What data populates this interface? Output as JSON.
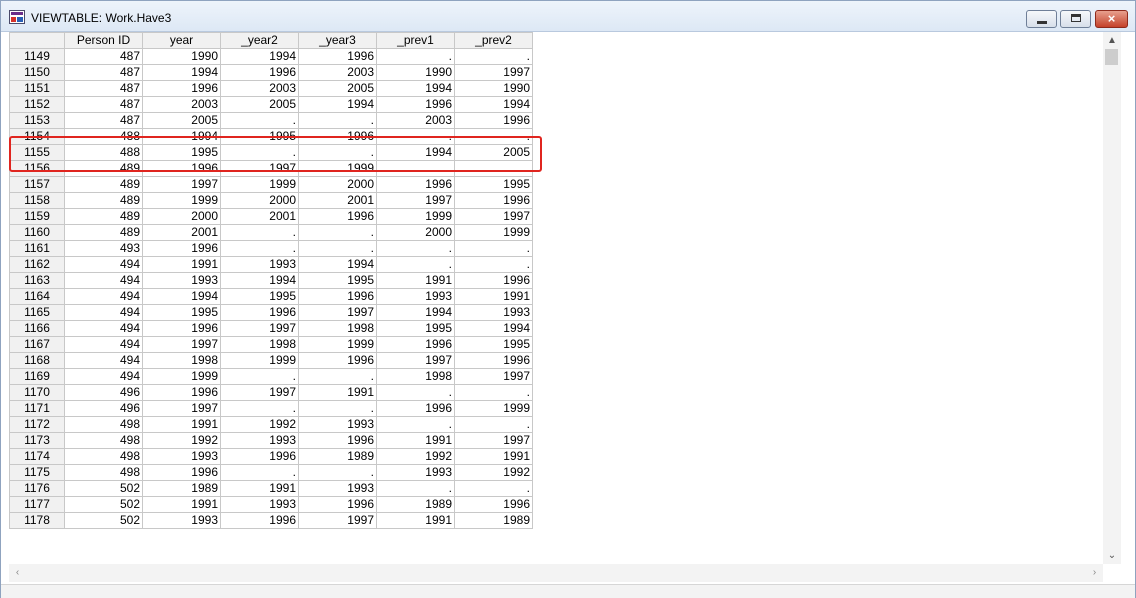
{
  "window": {
    "title": "VIEWTABLE: Work.Have3",
    "controls": {
      "minimize": "minimize",
      "maximize": "maximize",
      "close": "×"
    }
  },
  "table": {
    "columns": [
      "",
      "Person ID",
      "year",
      "_year2",
      "_year3",
      "_prev1",
      "_prev2"
    ],
    "rows": [
      [
        "1149",
        "487",
        "1990",
        "1994",
        "1996",
        ".",
        "."
      ],
      [
        "1150",
        "487",
        "1994",
        "1996",
        "2003",
        "1990",
        "1997"
      ],
      [
        "1151",
        "487",
        "1996",
        "2003",
        "2005",
        "1994",
        "1990"
      ],
      [
        "1152",
        "487",
        "2003",
        "2005",
        "1994",
        "1996",
        "1994"
      ],
      [
        "1153",
        "487",
        "2005",
        ".",
        ".",
        "2003",
        "1996"
      ],
      [
        "1154",
        "488",
        "1994",
        "1995",
        "1996",
        ".",
        "."
      ],
      [
        "1155",
        "488",
        "1995",
        ".",
        ".",
        "1994",
        "2005"
      ],
      [
        "1156",
        "489",
        "1996",
        "1997",
        "1999",
        ".",
        "."
      ],
      [
        "1157",
        "489",
        "1997",
        "1999",
        "2000",
        "1996",
        "1995"
      ],
      [
        "1158",
        "489",
        "1999",
        "2000",
        "2001",
        "1997",
        "1996"
      ],
      [
        "1159",
        "489",
        "2000",
        "2001",
        "1996",
        "1999",
        "1997"
      ],
      [
        "1160",
        "489",
        "2001",
        ".",
        ".",
        "2000",
        "1999"
      ],
      [
        "1161",
        "493",
        "1996",
        ".",
        ".",
        ".",
        "."
      ],
      [
        "1162",
        "494",
        "1991",
        "1993",
        "1994",
        ".",
        "."
      ],
      [
        "1163",
        "494",
        "1993",
        "1994",
        "1995",
        "1991",
        "1996"
      ],
      [
        "1164",
        "494",
        "1994",
        "1995",
        "1996",
        "1993",
        "1991"
      ],
      [
        "1165",
        "494",
        "1995",
        "1996",
        "1997",
        "1994",
        "1993"
      ],
      [
        "1166",
        "494",
        "1996",
        "1997",
        "1998",
        "1995",
        "1994"
      ],
      [
        "1167",
        "494",
        "1997",
        "1998",
        "1999",
        "1996",
        "1995"
      ],
      [
        "1168",
        "494",
        "1998",
        "1999",
        "1996",
        "1997",
        "1996"
      ],
      [
        "1169",
        "494",
        "1999",
        ".",
        ".",
        "1998",
        "1997"
      ],
      [
        "1170",
        "496",
        "1996",
        "1997",
        "1991",
        ".",
        "."
      ],
      [
        "1171",
        "496",
        "1997",
        ".",
        ".",
        "1996",
        "1999"
      ],
      [
        "1172",
        "498",
        "1991",
        "1992",
        "1993",
        ".",
        "."
      ],
      [
        "1173",
        "498",
        "1992",
        "1993",
        "1996",
        "1991",
        "1997"
      ],
      [
        "1174",
        "498",
        "1993",
        "1996",
        "1989",
        "1992",
        "1991"
      ],
      [
        "1175",
        "498",
        "1996",
        ".",
        ".",
        "1993",
        "1992"
      ],
      [
        "1176",
        "502",
        "1989",
        "1991",
        "1993",
        ".",
        "."
      ],
      [
        "1177",
        "502",
        "1991",
        "1993",
        "1996",
        "1989",
        "1996"
      ],
      [
        "1178",
        "502",
        "1993",
        "1996",
        "1997",
        "1991",
        "1989"
      ]
    ]
  },
  "colors": {
    "highlight": "#e0251f",
    "header_bg": "#f1f1f1"
  },
  "icons": {
    "app": "viewtable-icon",
    "scroll_up": "chevron-up-icon",
    "scroll_down": "chevron-down-icon"
  }
}
